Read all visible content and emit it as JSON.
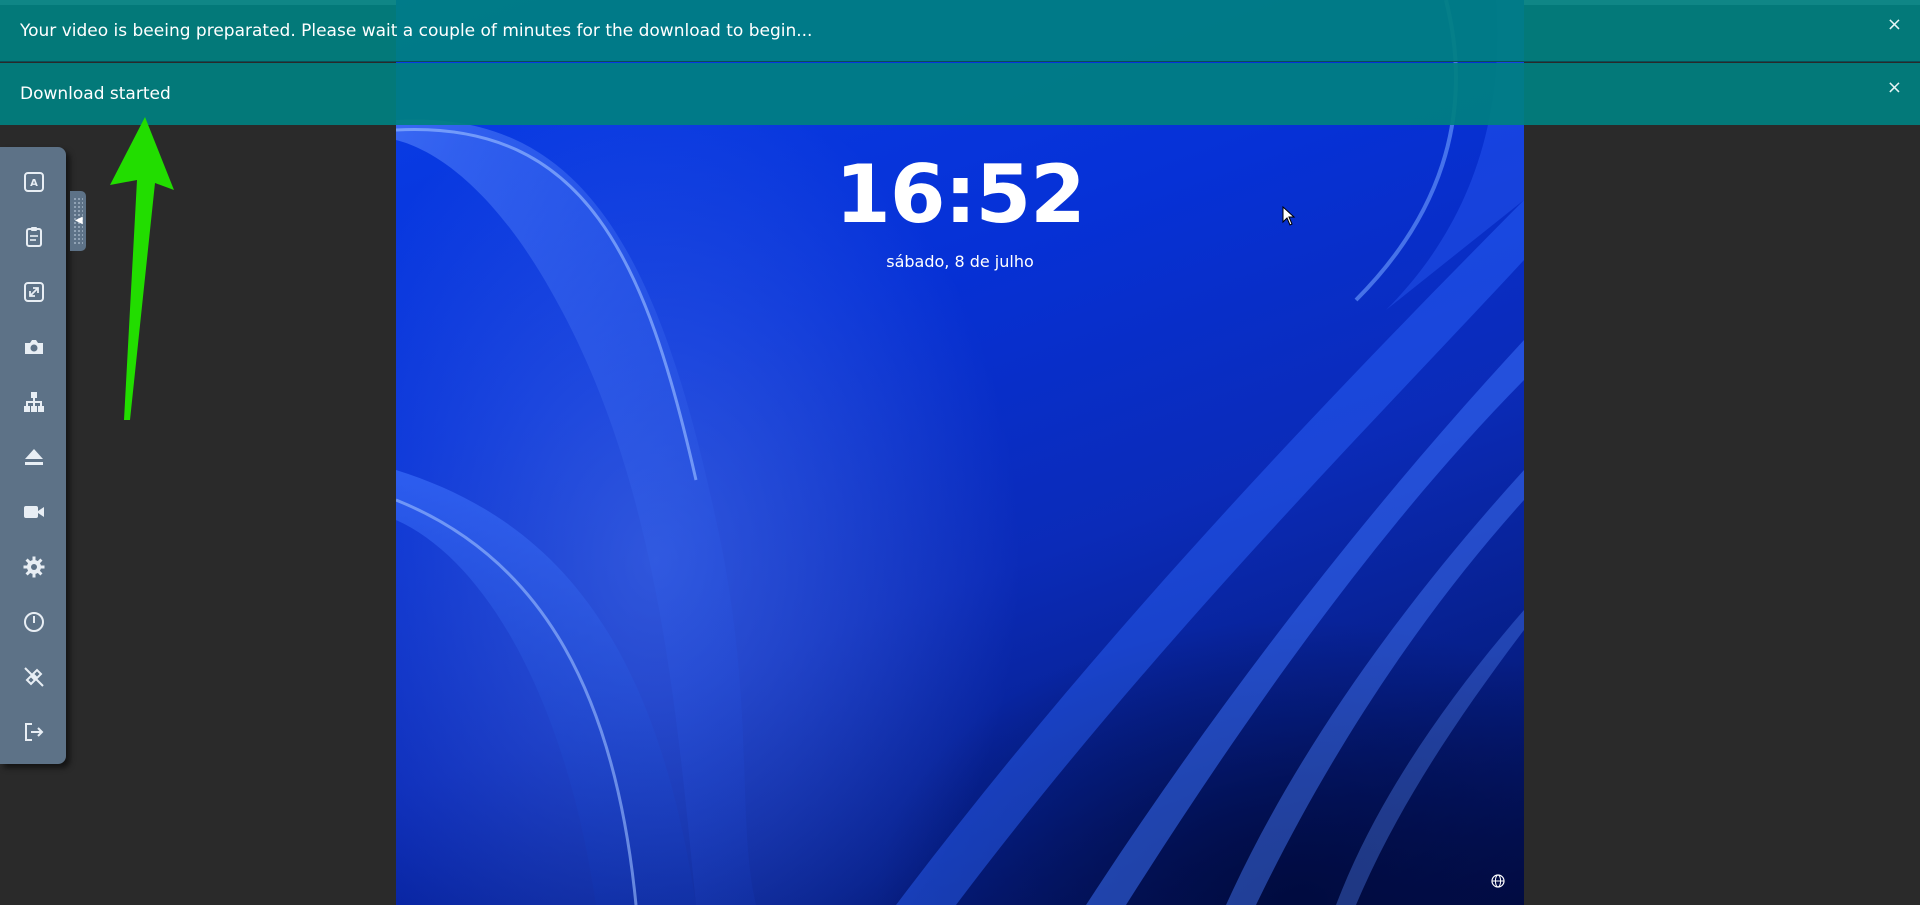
{
  "notifications": [
    {
      "text": "Your video is beeing preparated. Please wait a couple of minutes for the download to begin...",
      "close": "×"
    },
    {
      "text": "Download started",
      "close": "×"
    }
  ],
  "lockscreen": {
    "time": "16:52",
    "date": "sábado, 8 de julho"
  },
  "toolbar": {
    "items": [
      {
        "icon": "keyboard-a-icon"
      },
      {
        "icon": "clipboard-icon"
      },
      {
        "icon": "fullscreen-icon"
      },
      {
        "icon": "camera-icon"
      },
      {
        "icon": "sitemap-icon"
      },
      {
        "icon": "eject-icon"
      },
      {
        "icon": "video-camera-icon"
      },
      {
        "icon": "gear-icon"
      },
      {
        "icon": "power-icon"
      },
      {
        "icon": "disconnect-icon"
      },
      {
        "icon": "logout-icon"
      }
    ],
    "handle_arrow": "◀"
  },
  "colors": {
    "notification_bg": "#008080",
    "toolbar_bg": "#5d7287",
    "page_bg": "#2a2a2a",
    "annotation_arrow": "#22dd00"
  }
}
